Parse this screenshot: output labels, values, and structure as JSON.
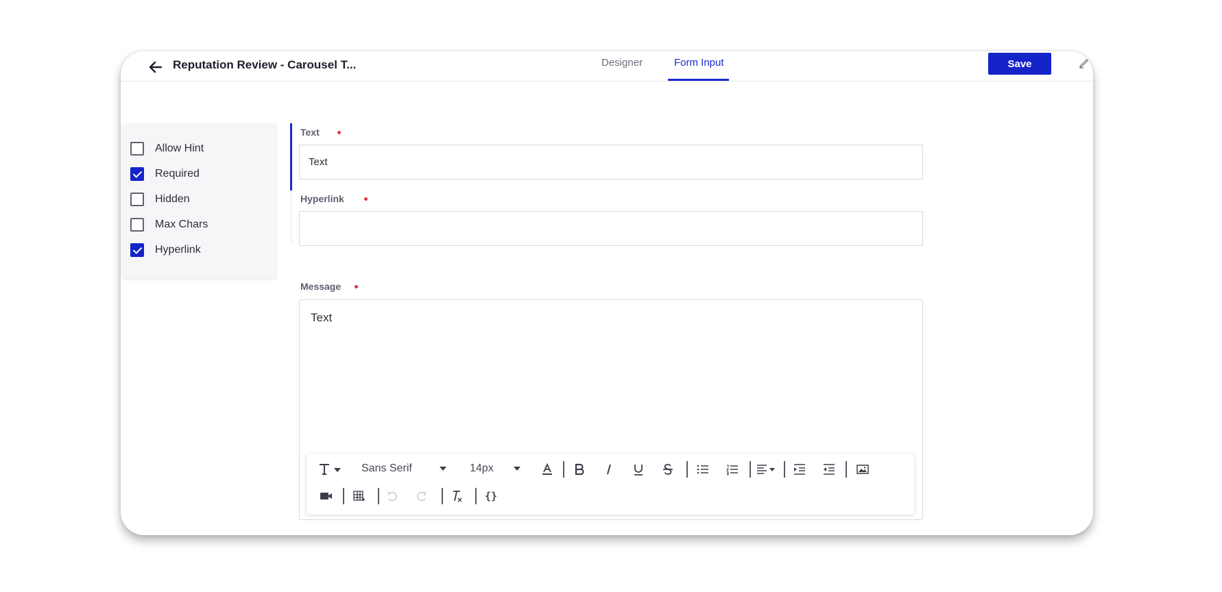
{
  "header": {
    "title": "Reputation Review - Carousel T...",
    "tabs": [
      {
        "label": "Designer",
        "active": false
      },
      {
        "label": "Form Input",
        "active": true
      }
    ],
    "save_label": "Save"
  },
  "sidebar": {
    "options": [
      {
        "label": "Allow Hint",
        "checked": false
      },
      {
        "label": "Required",
        "checked": true
      },
      {
        "label": "Hidden",
        "checked": false
      },
      {
        "label": "Max Chars",
        "checked": false
      },
      {
        "label": "Hyperlink",
        "checked": true
      }
    ]
  },
  "form": {
    "text_field": {
      "label": "Text",
      "value": "Text",
      "required": true
    },
    "hyperlink_field": {
      "label": "Hyperlink",
      "value": "",
      "required": true
    },
    "message_field": {
      "label": "Message",
      "value": "Text",
      "required": true
    }
  },
  "editor_toolbar": {
    "font_family": "Sans Serif",
    "font_size": "14px",
    "code_label": "{}"
  },
  "colors": {
    "accent": "#1524c9",
    "required_dot": "#e0344a"
  }
}
